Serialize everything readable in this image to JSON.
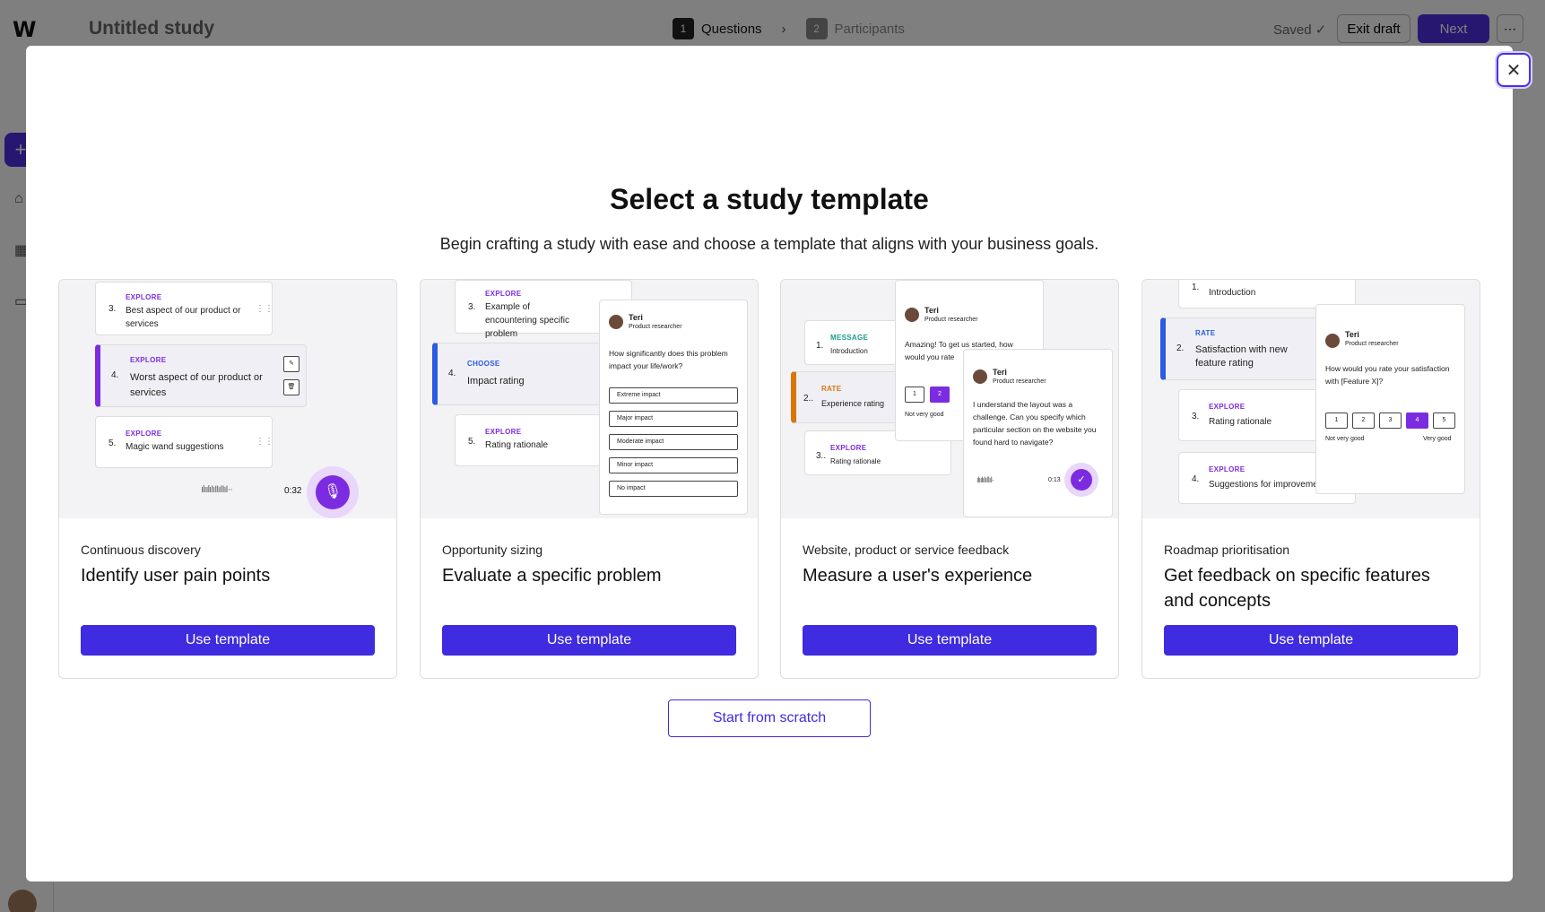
{
  "app": {
    "logo": "W",
    "study_title": "Untitled study",
    "steps": [
      {
        "num": "1",
        "label": "Questions"
      },
      {
        "num": "2",
        "label": "Participants"
      }
    ],
    "saved": "Saved ✓",
    "exit_label": "Exit draft",
    "next_label": "Next",
    "more_label": "⋯"
  },
  "modal": {
    "title": "Select a study template",
    "subtitle": "Begin crafting a study with ease and choose a template that aligns with your business goals.",
    "close_label": "✕",
    "scratch_label": "Start from scratch",
    "cards": [
      {
        "category": "Continuous discovery",
        "title": "Identify user pain points",
        "button": "Use template"
      },
      {
        "category": "Opportunity sizing",
        "title": "Evaluate a specific problem",
        "button": "Use template"
      },
      {
        "category": "Website, product or service feedback",
        "title": "Measure a user's experience",
        "button": "Use template"
      },
      {
        "category": "Roadmap prioritisation",
        "title": "Get feedback on specific features and concepts",
        "button": "Use template"
      }
    ]
  },
  "previews": {
    "p1": {
      "q3": {
        "num": "3.",
        "tag": "EXPLORE",
        "text": "Best aspect of our product or services"
      },
      "q4": {
        "num": "4.",
        "tag": "EXPLORE",
        "text": "Worst aspect of our product or services"
      },
      "q5": {
        "num": "5.",
        "tag": "EXPLORE",
        "text": "Magic wand suggestions"
      },
      "time": "0:32"
    },
    "p2": {
      "q3": {
        "num": "3.",
        "tag": "EXPLORE",
        "text": "Example of encountering specific problem"
      },
      "q4": {
        "num": "4.",
        "tag": "CHOOSE",
        "text": "Impact rating"
      },
      "q5": {
        "num": "5.",
        "tag": "EXPLORE",
        "text": "Rating rationale"
      },
      "name": "Teri",
      "role": "Product researcher",
      "question": "How significantly does this problem impact your life/work?",
      "options": [
        "Extreme impact",
        "Major impact",
        "Moderate impact",
        "Minor impact",
        "No impact"
      ]
    },
    "p3": {
      "q1": {
        "num": "1.",
        "tag": "MESSAGE",
        "text": "Introduction"
      },
      "q2": {
        "num": "2..",
        "tag": "RATE",
        "text": "Experience rating"
      },
      "q3": {
        "num": "3..",
        "tag": "EXPLORE",
        "text": "Rating rationale"
      },
      "name": "Teri",
      "role": "Product researcher",
      "chat1": "Amazing! To get us started, how would you rate",
      "ratings": [
        "1",
        "2"
      ],
      "low_label": "Not very good",
      "chat2": "I understand the layout was a challenge. Can you specify which particular section on the website you found hard to navigate?",
      "time": "0:13"
    },
    "p4": {
      "q1": {
        "num": "1.",
        "text": "Introduction"
      },
      "q2": {
        "num": "2.",
        "tag": "RATE",
        "text": "Satisfaction with new feature rating"
      },
      "q3": {
        "num": "3.",
        "tag": "EXPLORE",
        "text": "Rating rationale"
      },
      "q4": {
        "num": "4.",
        "tag": "EXPLORE",
        "text": "Suggestions for improvement"
      },
      "name": "Teri",
      "role": "Product researcher",
      "question": "How would you rate your satisfaction with [Feature X]?",
      "ratings": [
        "1",
        "2",
        "3",
        "4",
        "5"
      ],
      "low_label": "Not very good",
      "high_label": "Very good"
    }
  },
  "colors": {
    "accent": "#3f2be0",
    "explore": "#7c2ce0",
    "choose": "#2b5be0",
    "rate": "#d97706",
    "message": "#1a9c8c"
  }
}
